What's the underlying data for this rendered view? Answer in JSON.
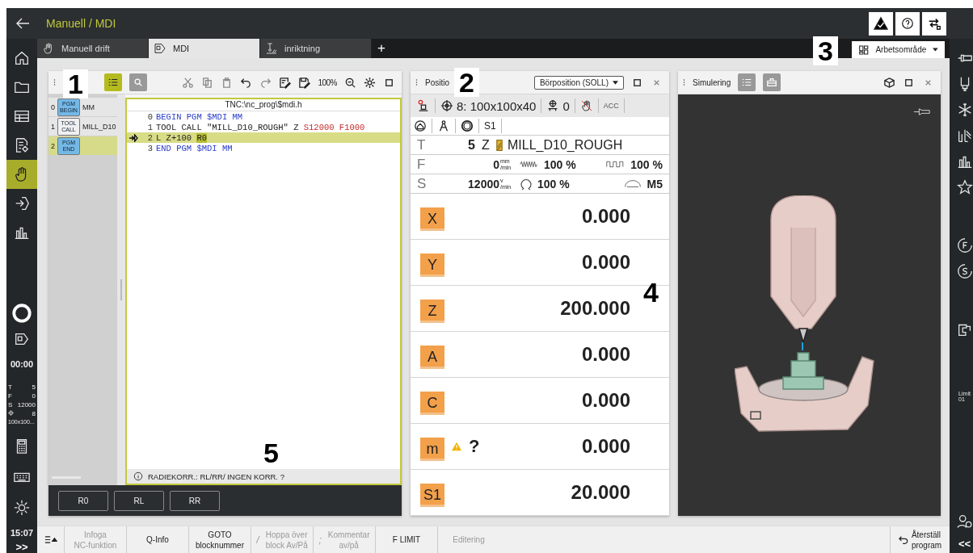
{
  "header": {
    "title": "Manuell / MDI"
  },
  "tabs": [
    {
      "label": "Manuell drift",
      "selected": false,
      "kind": "hand"
    },
    {
      "label": "MDI",
      "selected": true,
      "kind": "mdi"
    },
    {
      "label": "inriktning",
      "selected": false,
      "kind": "probe"
    }
  ],
  "add_tab": "+",
  "workspace": {
    "label": "Arbetsområde"
  },
  "left_nav": {
    "items": [
      {
        "kind": "home",
        "selected": false
      },
      {
        "kind": "folder",
        "selected": false
      },
      {
        "kind": "table",
        "selected": false
      },
      {
        "kind": "file",
        "selected": false
      },
      {
        "kind": "hand",
        "selected": true
      },
      {
        "kind": "run",
        "selected": false
      },
      {
        "kind": "chart",
        "selected": false
      }
    ],
    "runtime": "00:00",
    "status": [
      {
        "label": "T",
        "value": "5"
      },
      {
        "label": "F",
        "value": "0"
      },
      {
        "label": "S",
        "value": "12000"
      }
    ],
    "datum_value": "8",
    "datum_name": "100x100...",
    "clock": "15:07",
    "expand": ">>"
  },
  "right_nav": {
    "items": [
      {
        "kind": "plug"
      },
      {
        "kind": "tool"
      },
      {
        "kind": "snow"
      },
      {
        "kind": "bars"
      },
      {
        "kind": "chart"
      },
      {
        "kind": "star"
      },
      {
        "kind": "gap"
      },
      {
        "kind": "feed"
      },
      {
        "kind": "spindle"
      },
      {
        "kind": "gap"
      },
      {
        "kind": "machine"
      }
    ],
    "limit_label": "Limit",
    "limit_value": "01",
    "collapse": "<<"
  },
  "program": {
    "zoom": "100%",
    "structure": [
      {
        "number": "0",
        "tag": [
          "PGM",
          "BEGIN"
        ],
        "color": "#74b8e6",
        "name": "MM",
        "selected": false
      },
      {
        "number": "1",
        "tag": [
          "TOOL",
          "CALL"
        ],
        "color": "#f0f0f0",
        "name": "MILL_D10",
        "selected": false
      },
      {
        "number": "2",
        "tag": [
          "PGM",
          "END"
        ],
        "color": "#74b8e6",
        "selected": true
      }
    ],
    "path": "TNC:\\nc_prog\\$mdi.h",
    "lines": [
      {
        "number": "0",
        "current": false,
        "tokens": [
          {
            "text": "BEGIN PGM $MDI MM",
            "kind": "keyword"
          }
        ]
      },
      {
        "number": "1",
        "current": false,
        "tokens": [
          {
            "text": "TOOL CALL \"MILL_D10_ROUGH\" Z ",
            "kind": "plain"
          },
          {
            "text": "S12000 F1000",
            "kind": "value"
          }
        ]
      },
      {
        "number": "2",
        "current": true,
        "tokens": [
          {
            "text": "L Z+100 ",
            "kind": "plain"
          },
          {
            "text": "R0",
            "kind": "mark"
          }
        ]
      },
      {
        "number": "3",
        "current": false,
        "tokens": [
          {
            "text": "END PGM $MDI MM",
            "kind": "keyword"
          }
        ]
      }
    ],
    "message": "RADIEKORR.: RL/RR/ INGEN KORR. ?",
    "softkeys": [
      "R0",
      "RL",
      "RR"
    ]
  },
  "position": {
    "title": "Positio",
    "mode": "Börposition (SOLL)",
    "datum": "8: 100x100x40",
    "preset": "0",
    "acc": "ACC",
    "spindle_ref": "S1",
    "tool": {
      "label": "T",
      "number": "5",
      "axis": "Z",
      "name": "MILL_D10_ROUGH"
    },
    "feed": {
      "label": "F",
      "value": "0",
      "unit_top": "mm",
      "unit_bottom": "/min",
      "override": "100 %",
      "rapid": "100 %"
    },
    "speed": {
      "label": "S",
      "value": "12000",
      "unit_top": "v",
      "unit_bottom": "/min",
      "override": "100 %",
      "mfunc": "M5"
    },
    "axes": [
      {
        "label": "X",
        "value": "0.000",
        "warning": false
      },
      {
        "label": "Y",
        "value": "0.000",
        "warning": false
      },
      {
        "label": "Z",
        "value": "200.000",
        "warning": false
      },
      {
        "label": "A",
        "value": "0.000",
        "warning": false
      },
      {
        "label": "C",
        "value": "0.000",
        "warning": false
      },
      {
        "label": "m",
        "value": "0.000",
        "warning": true,
        "note": "?"
      },
      {
        "label": "S1",
        "value": "20.000",
        "warning": false
      }
    ]
  },
  "simulation": {
    "title": "Simulering"
  },
  "bottom_bar": {
    "items": [
      {
        "lines": [
          "Infoga",
          "NC-funktion"
        ],
        "disabled": true
      },
      {
        "lines": [
          "Q-Info"
        ],
        "disabled": false
      },
      {
        "lines": [
          "GOTO",
          "blocknummer"
        ],
        "disabled": false
      },
      {
        "prefix": "/",
        "lines": [
          "Hoppa över",
          "block Av/På"
        ],
        "disabled": true
      },
      {
        "prefix": ";",
        "lines": [
          "Kommentar",
          "av/på"
        ],
        "disabled": true
      },
      {
        "lines": [
          "F LIMIT"
        ],
        "disabled": false
      },
      {
        "lines": [
          "Editering"
        ],
        "disabled": true
      }
    ],
    "reset": [
      "Återställ",
      "program"
    ]
  },
  "callouts": [
    "1",
    "2",
    "3",
    "4",
    "5"
  ]
}
